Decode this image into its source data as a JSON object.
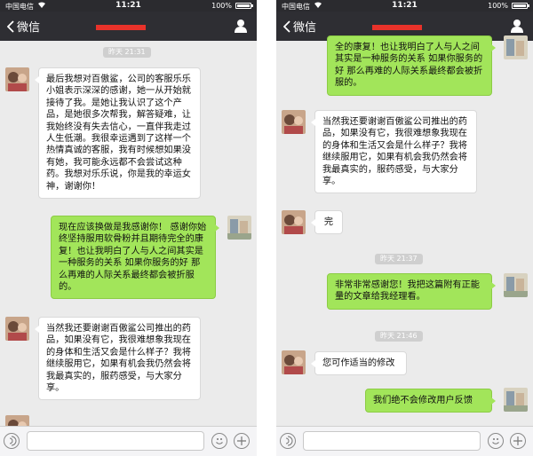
{
  "status": {
    "carrier": "中国电信",
    "time": "11:21",
    "battery": "100%"
  },
  "nav": {
    "back_label": "微信"
  },
  "colors": {
    "nav_bg": "#2e2e33",
    "bubble_out": "#a2e55a",
    "bubble_in": "#ffffff",
    "chat_bg": "#ebebeb",
    "redacted": "#e8322a"
  },
  "left": {
    "timestamps": [
      "昨天 21:31"
    ],
    "messages": [
      {
        "from": "other",
        "text": "最后我想对百傲鲨，公司的客服乐乐小姐表示深深的感谢，她一从开始就接待了我。是她让我认识了这个产品，是她很多次帮我，解答疑难，让我始终没有失去信心，一直伴我走过人生低潮。我很幸运遇到了这样一个热情真诚的客服，我有时候想如果没有她，我可能永远都不会尝试这种药。我想对乐乐说，你是我的幸运女神，谢谢你！"
      },
      {
        "from": "me",
        "text": "现在应该换做是我感谢你！  感谢你始终坚持服用软骨粉并且期待完全的康复！也让我明白了人与人之间其实是一种服务的关系  如果你服务的好 那么再难的人际关系最终都会被折服的。"
      },
      {
        "from": "other",
        "text": "当然我还要谢谢百傲鲨公司推出的药品，如果没有它，我很难想象我现在的身体和生活又会是什么样子？我将继续服用它，如果有机会我仍然会将我最真实的，服药感受，与大家分享。"
      }
    ]
  },
  "right": {
    "timestamps": [
      "昨天 21:37",
      "昨天 21:46"
    ],
    "messages": [
      {
        "from": "me",
        "text": "全的康复！也让我明白了人与人之间其实是一种服务的关系  如果你服务的好 那么再难的人际关系最终都会被折服的。"
      },
      {
        "from": "other",
        "text": "当然我还要谢谢百傲鲨公司推出的药品，如果没有它，我很难想象我现在的身体和生活又会是什么样子？我将继续服用它，如果有机会我仍然会将我最真实的，服药感受，与大家分享。"
      },
      {
        "from": "other",
        "text": "完"
      },
      {
        "from": "me",
        "text": "非常非常感谢您！我把这篇附有正能量的文章给我经理看。"
      },
      {
        "from": "other",
        "text": "您可作适当的修改"
      },
      {
        "from": "me",
        "text": "我们绝不会修改用户反馈"
      }
    ]
  }
}
